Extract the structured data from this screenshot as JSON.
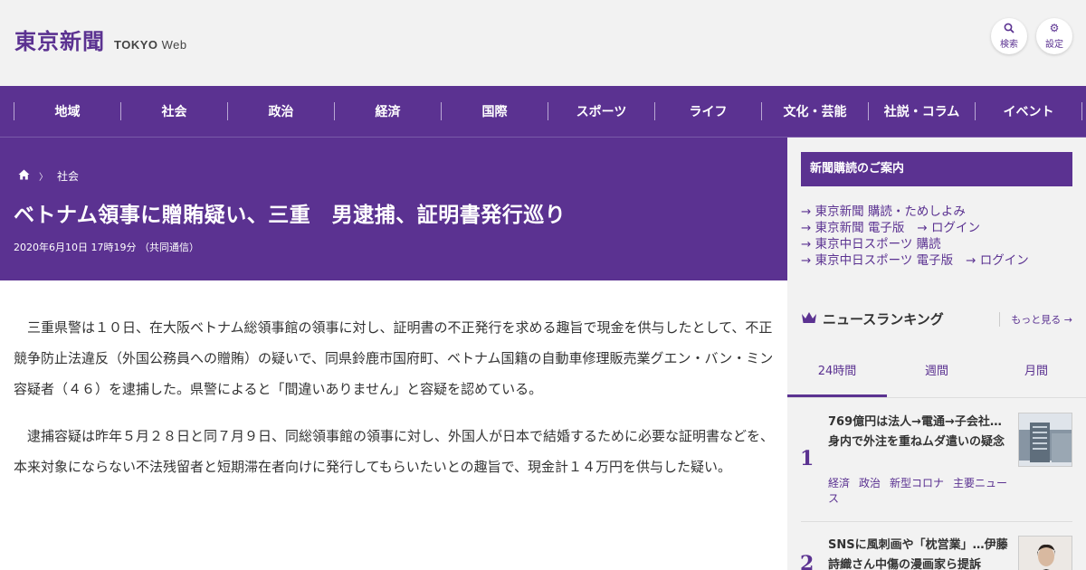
{
  "header": {
    "logo_text": "東京新聞",
    "logo_sub_bold": "TOKYO",
    "logo_sub": " Web",
    "search_label": "検索",
    "settings_label": "設定",
    "accent_color": "#5b3291"
  },
  "nav": {
    "items": [
      "地域",
      "社会",
      "政治",
      "経済",
      "国際",
      "スポーツ",
      "ライフ",
      "文化・芸能",
      "社説・コラム",
      "イベント"
    ]
  },
  "article": {
    "breadcrumb": "社会",
    "title": "ベトナム領事に贈賄疑い、三重　男逮捕、証明書発行巡り",
    "dateline": "2020年6月10日 17時19分 （共同通信）",
    "paragraphs": [
      "三重県警は１０日、在大阪ベトナム総領事館の領事に対し、証明書の不正発行を求める趣旨で現金を供与したとして、不正競争防止法違反（外国公務員への贈賄）の疑いで、同県鈴鹿市国府町、ベトナム国籍の自動車修理販売業グエン・バン・ミン容疑者（４６）を逮捕した。県警によると「間違いありません」と容疑を認めている。",
      "逮捕容疑は昨年５月２８日と同７月９日、同総領事館の領事に対し、外国人が日本で結婚するために必要な証明書などを、本来対象にならない不法残留者と短期滞在者向けに発行してもらいたいとの趣旨で、現金計１４万円を供与した疑い。"
    ]
  },
  "sidebar": {
    "subscribe_title": "新聞購読のご案内",
    "links": {
      "l1": "東京新聞 購読・ためしよみ",
      "l2": "東京新聞 電子版",
      "l2b": "ログイン",
      "l3": "東京中日スポーツ 購読",
      "l4": "東京中日スポーツ 電子版",
      "l4b": "ログイン"
    },
    "ranking_title": "ニュースランキング",
    "more_label": "もっと見る",
    "tabs": [
      "24時間",
      "週間",
      "月間"
    ],
    "ranking": [
      {
        "rank": "1",
        "title": "769億円は法人→電通→子会社…身内で外注を重ねムダ遣いの疑念",
        "tags": [
          "経済",
          "政治",
          "新型コロナ",
          "主要ニュース"
        ]
      },
      {
        "rank": "2",
        "title": "SNSに風刺画や「枕営業」…伊藤詩織さん中傷の漫画家ら提訴",
        "tags": []
      }
    ]
  }
}
